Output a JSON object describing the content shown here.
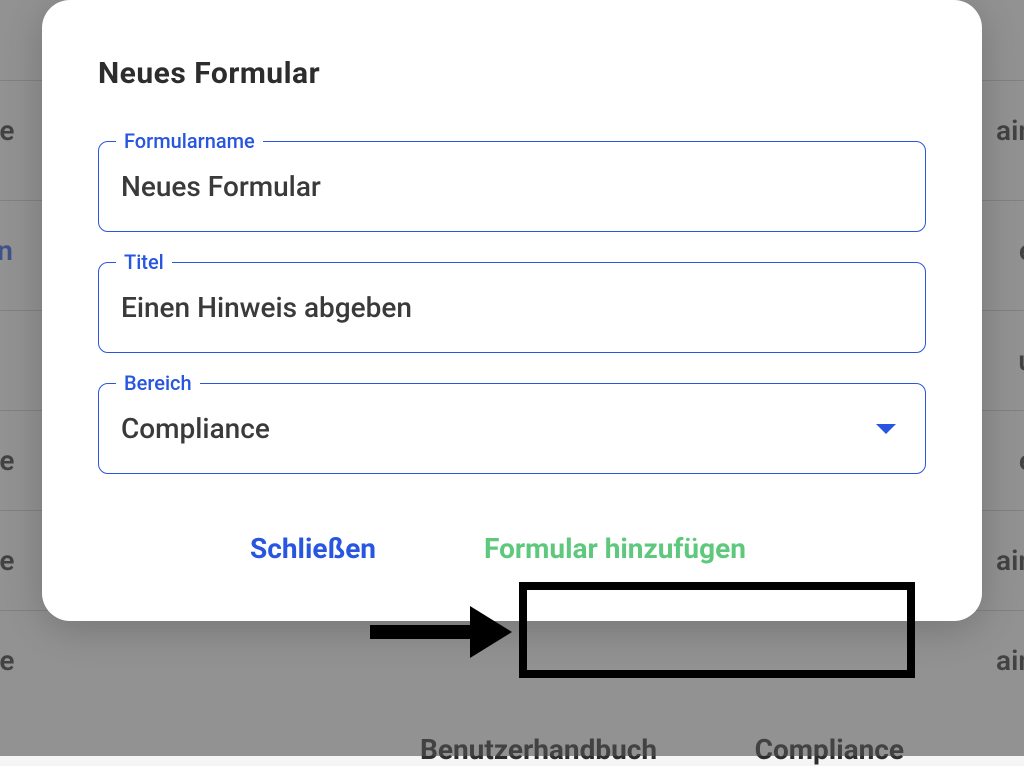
{
  "background": {
    "rows": [
      {
        "left": "te",
        "right": "ain"
      },
      {
        "left": "in",
        "right": "e",
        "blue": true
      },
      {
        "left": "",
        "right": "u"
      },
      {
        "left": "te",
        "right": "e"
      },
      {
        "left": "te",
        "right": "ain"
      },
      {
        "left": "te",
        "right": "ain"
      }
    ],
    "footer_left": "Benutzerhandbuch",
    "footer_right": "Compliance"
  },
  "modal": {
    "title": "Neues Formular",
    "fields": {
      "formname": {
        "label": "Formularname",
        "value": "Neues Formular"
      },
      "title": {
        "label": "Titel",
        "value": "Einen Hinweis abgeben"
      },
      "area": {
        "label": "Bereich",
        "value": "Compliance"
      }
    },
    "actions": {
      "close": "Schließen",
      "add": "Formular hinzufügen"
    }
  }
}
